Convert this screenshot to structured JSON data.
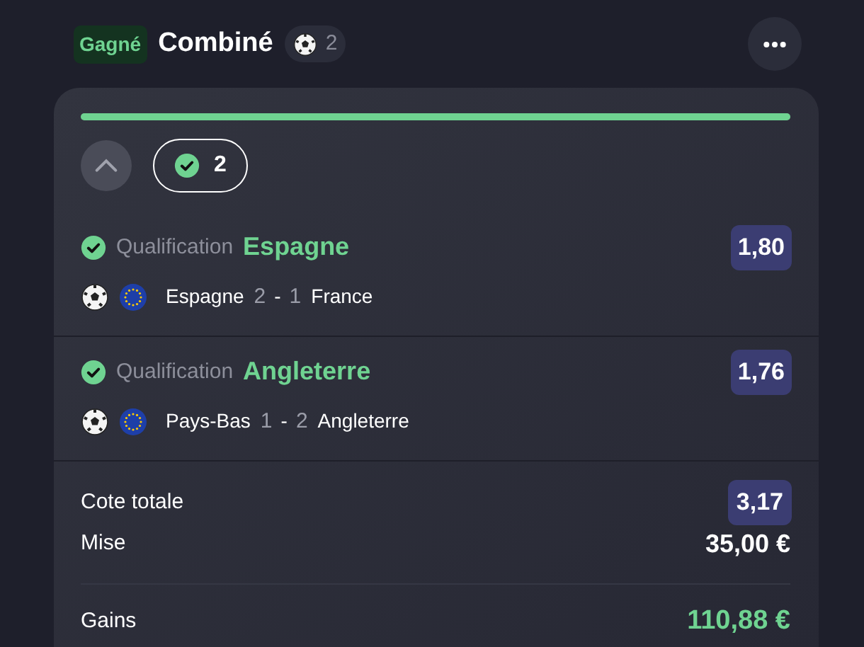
{
  "header": {
    "status": "Gagné",
    "title": "Combiné",
    "sport_count": "2"
  },
  "progress": {
    "level": 1
  },
  "toggle": {
    "expanded": true
  },
  "won_badge": {
    "count": "2"
  },
  "selections": [
    {
      "won": true,
      "market": "Qualification",
      "pick": "Espagne",
      "odds": "1,80",
      "home": "Espagne",
      "home_score": "2",
      "separator": "-",
      "away_score": "1",
      "away": "France"
    },
    {
      "won": true,
      "market": "Qualification",
      "pick": "Angleterre",
      "odds": "1,76",
      "home": "Pays-Bas",
      "home_score": "1",
      "separator": "-",
      "away_score": "2",
      "away": "Angleterre"
    }
  ],
  "summary": {
    "total_odds_label": "Cote totale",
    "total_odds": "3,17",
    "stake_label": "Mise",
    "stake": "35,00 €",
    "winnings_label": "Gains",
    "winnings": "110,88 €"
  }
}
